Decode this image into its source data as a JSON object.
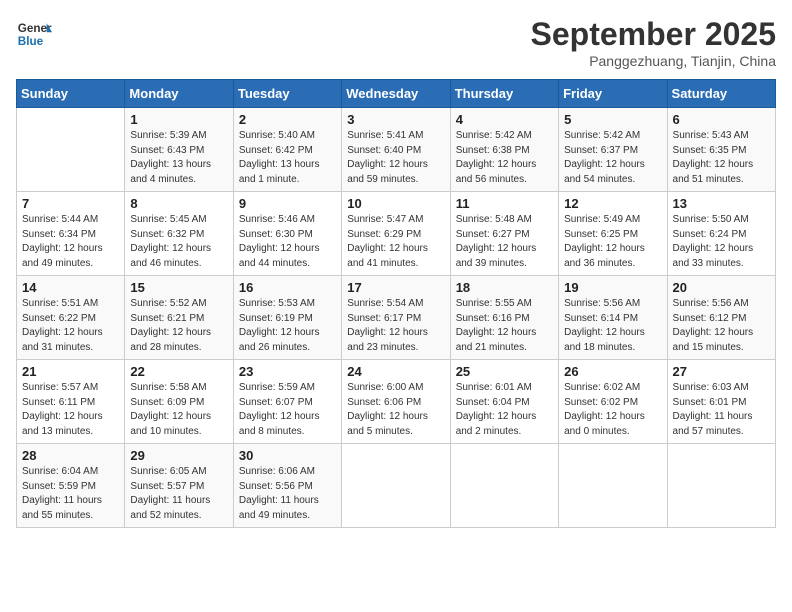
{
  "header": {
    "logo_line1": "General",
    "logo_line2": "Blue",
    "month": "September 2025",
    "location": "Panggezhuang, Tianjin, China"
  },
  "days_of_week": [
    "Sunday",
    "Monday",
    "Tuesday",
    "Wednesday",
    "Thursday",
    "Friday",
    "Saturday"
  ],
  "weeks": [
    [
      {
        "num": "",
        "info": ""
      },
      {
        "num": "1",
        "info": "Sunrise: 5:39 AM\nSunset: 6:43 PM\nDaylight: 13 hours\nand 4 minutes."
      },
      {
        "num": "2",
        "info": "Sunrise: 5:40 AM\nSunset: 6:42 PM\nDaylight: 13 hours\nand 1 minute."
      },
      {
        "num": "3",
        "info": "Sunrise: 5:41 AM\nSunset: 6:40 PM\nDaylight: 12 hours\nand 59 minutes."
      },
      {
        "num": "4",
        "info": "Sunrise: 5:42 AM\nSunset: 6:38 PM\nDaylight: 12 hours\nand 56 minutes."
      },
      {
        "num": "5",
        "info": "Sunrise: 5:42 AM\nSunset: 6:37 PM\nDaylight: 12 hours\nand 54 minutes."
      },
      {
        "num": "6",
        "info": "Sunrise: 5:43 AM\nSunset: 6:35 PM\nDaylight: 12 hours\nand 51 minutes."
      }
    ],
    [
      {
        "num": "7",
        "info": "Sunrise: 5:44 AM\nSunset: 6:34 PM\nDaylight: 12 hours\nand 49 minutes."
      },
      {
        "num": "8",
        "info": "Sunrise: 5:45 AM\nSunset: 6:32 PM\nDaylight: 12 hours\nand 46 minutes."
      },
      {
        "num": "9",
        "info": "Sunrise: 5:46 AM\nSunset: 6:30 PM\nDaylight: 12 hours\nand 44 minutes."
      },
      {
        "num": "10",
        "info": "Sunrise: 5:47 AM\nSunset: 6:29 PM\nDaylight: 12 hours\nand 41 minutes."
      },
      {
        "num": "11",
        "info": "Sunrise: 5:48 AM\nSunset: 6:27 PM\nDaylight: 12 hours\nand 39 minutes."
      },
      {
        "num": "12",
        "info": "Sunrise: 5:49 AM\nSunset: 6:25 PM\nDaylight: 12 hours\nand 36 minutes."
      },
      {
        "num": "13",
        "info": "Sunrise: 5:50 AM\nSunset: 6:24 PM\nDaylight: 12 hours\nand 33 minutes."
      }
    ],
    [
      {
        "num": "14",
        "info": "Sunrise: 5:51 AM\nSunset: 6:22 PM\nDaylight: 12 hours\nand 31 minutes."
      },
      {
        "num": "15",
        "info": "Sunrise: 5:52 AM\nSunset: 6:21 PM\nDaylight: 12 hours\nand 28 minutes."
      },
      {
        "num": "16",
        "info": "Sunrise: 5:53 AM\nSunset: 6:19 PM\nDaylight: 12 hours\nand 26 minutes."
      },
      {
        "num": "17",
        "info": "Sunrise: 5:54 AM\nSunset: 6:17 PM\nDaylight: 12 hours\nand 23 minutes."
      },
      {
        "num": "18",
        "info": "Sunrise: 5:55 AM\nSunset: 6:16 PM\nDaylight: 12 hours\nand 21 minutes."
      },
      {
        "num": "19",
        "info": "Sunrise: 5:56 AM\nSunset: 6:14 PM\nDaylight: 12 hours\nand 18 minutes."
      },
      {
        "num": "20",
        "info": "Sunrise: 5:56 AM\nSunset: 6:12 PM\nDaylight: 12 hours\nand 15 minutes."
      }
    ],
    [
      {
        "num": "21",
        "info": "Sunrise: 5:57 AM\nSunset: 6:11 PM\nDaylight: 12 hours\nand 13 minutes."
      },
      {
        "num": "22",
        "info": "Sunrise: 5:58 AM\nSunset: 6:09 PM\nDaylight: 12 hours\nand 10 minutes."
      },
      {
        "num": "23",
        "info": "Sunrise: 5:59 AM\nSunset: 6:07 PM\nDaylight: 12 hours\nand 8 minutes."
      },
      {
        "num": "24",
        "info": "Sunrise: 6:00 AM\nSunset: 6:06 PM\nDaylight: 12 hours\nand 5 minutes."
      },
      {
        "num": "25",
        "info": "Sunrise: 6:01 AM\nSunset: 6:04 PM\nDaylight: 12 hours\nand 2 minutes."
      },
      {
        "num": "26",
        "info": "Sunrise: 6:02 AM\nSunset: 6:02 PM\nDaylight: 12 hours\nand 0 minutes."
      },
      {
        "num": "27",
        "info": "Sunrise: 6:03 AM\nSunset: 6:01 PM\nDaylight: 11 hours\nand 57 minutes."
      }
    ],
    [
      {
        "num": "28",
        "info": "Sunrise: 6:04 AM\nSunset: 5:59 PM\nDaylight: 11 hours\nand 55 minutes."
      },
      {
        "num": "29",
        "info": "Sunrise: 6:05 AM\nSunset: 5:57 PM\nDaylight: 11 hours\nand 52 minutes."
      },
      {
        "num": "30",
        "info": "Sunrise: 6:06 AM\nSunset: 5:56 PM\nDaylight: 11 hours\nand 49 minutes."
      },
      {
        "num": "",
        "info": ""
      },
      {
        "num": "",
        "info": ""
      },
      {
        "num": "",
        "info": ""
      },
      {
        "num": "",
        "info": ""
      }
    ]
  ]
}
